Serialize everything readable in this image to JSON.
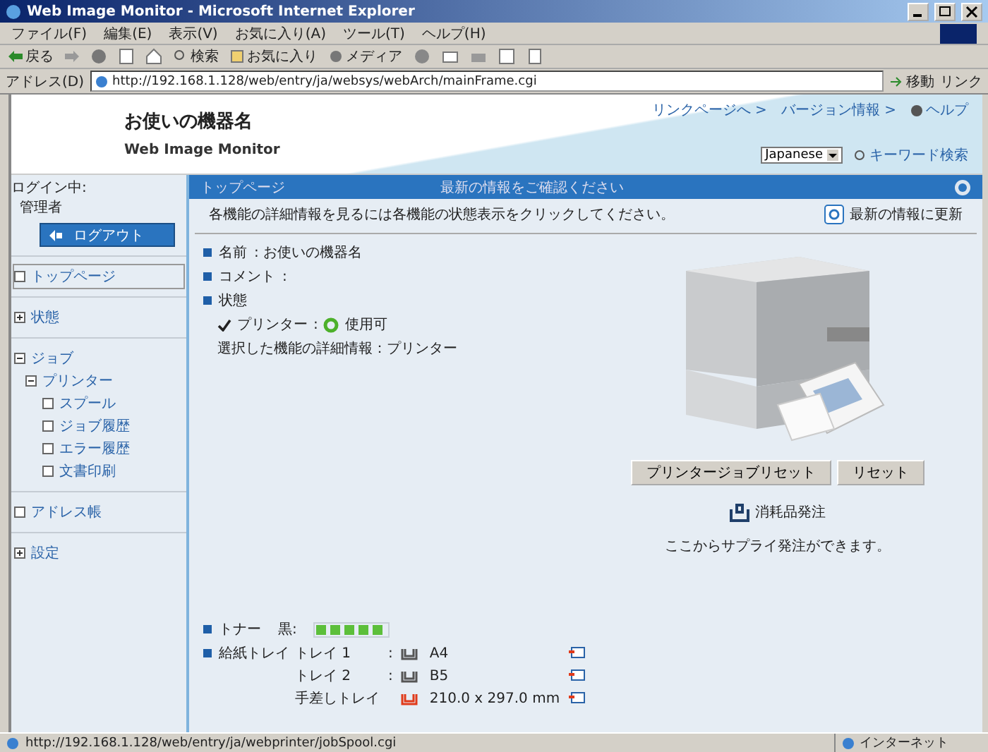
{
  "window": {
    "title": "Web Image Monitor - Microsoft Internet Explorer"
  },
  "menu": [
    "ファイル(F)",
    "編集(E)",
    "表示(V)",
    "お気に入り(A)",
    "ツール(T)",
    "ヘルプ(H)"
  ],
  "toolbar": {
    "back": "戻る",
    "search": "検索",
    "favorites": "お気に入り",
    "media": "メディア"
  },
  "address_bar": {
    "label": "アドレス(D)",
    "url": "http://192.168.1.128/web/entry/ja/websys/webArch/mainFrame.cgi",
    "go": "移動",
    "links": "リンク"
  },
  "header": {
    "device_name": "お使いの機器名",
    "product": "Web Image Monitor",
    "links": [
      "リンクページへ >",
      "バージョン情報 >"
    ],
    "help": "ヘルプ",
    "language": "Japanese",
    "keyword_search": "キーワード検索"
  },
  "sidebar": {
    "login_label": "ログイン中:",
    "user": "管理者",
    "logout": "ログアウト",
    "items": [
      {
        "label": "トップページ",
        "selected": true
      },
      {
        "label": "状態",
        "selected": false,
        "expanded": false
      },
      {
        "label": "ジョブ",
        "selected": false,
        "expanded": true,
        "children": [
          {
            "label": "プリンター",
            "selected": false,
            "expanded": true,
            "children": [
              {
                "label": "スプール",
                "selected": false
              },
              {
                "label": "ジョブ履歴",
                "selected": false
              },
              {
                "label": "エラー履歴",
                "selected": false
              },
              {
                "label": "文書印刷",
                "selected": false
              }
            ]
          }
        ]
      },
      {
        "label": "アドレス帳",
        "selected": false
      },
      {
        "label": "設定",
        "selected": false,
        "expanded": false
      }
    ]
  },
  "main": {
    "breadcrumb": "トップページ",
    "notice": "最新の情報をご確認ください",
    "instruction": "各機能の詳細情報を見るには各機能の状態表示をクリックしてください。",
    "refresh": "最新の情報に更新",
    "info": [
      {
        "label": "名前",
        "value": ": お使いの機器名"
      },
      {
        "label": "コメント",
        "value": ":"
      },
      {
        "label": "状態"
      }
    ],
    "status": {
      "function": "プリンター",
      "separator": ":",
      "state": "使用可"
    },
    "selected_detail": "選択した機能の詳細情報：プリンター",
    "buttons": [
      "プリンタージョブリセット",
      "リセット"
    ],
    "toner": {
      "label": "トナー",
      "color_name": "黒:",
      "level": 1.0
    },
    "trays": {
      "label": "給紙トレイ",
      "rows": [
        {
          "name": "トレイ 1",
          "sep": ":",
          "paper": "A4",
          "kind": "normal"
        },
        {
          "name": "トレイ 2",
          "sep": ":",
          "paper": "B5",
          "kind": "normal"
        },
        {
          "name": "手差しトレイ",
          "sep": "",
          "paper": "210.0 x 297.0 mm",
          "kind": "warning"
        }
      ]
    },
    "supply": {
      "order": "消耗品発注",
      "note": "ここからサプライ発注ができます。"
    }
  },
  "status_bar": {
    "url": "http://192.168.1.128/web/entry/ja/webprinter/jobSpool.cgi",
    "zone": "インターネット"
  }
}
